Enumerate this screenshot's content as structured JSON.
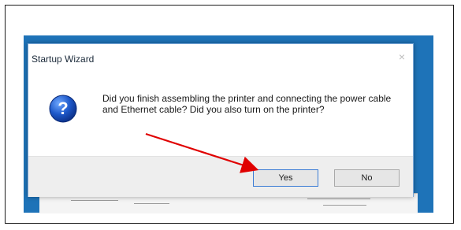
{
  "dialog": {
    "title": "Startup Wizard",
    "close_glyph": "×",
    "icon": "question-icon",
    "message": "Did you finish assembling the printer and connecting the power cable and Ethernet cable? Did you also turn on the printer?",
    "buttons": {
      "yes": "Yes",
      "no": "No"
    },
    "default_button": "yes"
  },
  "annotation": {
    "arrow_color": "#e00000",
    "points_to": "yes-button"
  },
  "colors": {
    "background_strip": "#1e73b8",
    "dialog_border": "#7aa7d6",
    "footer": "#eeeeee"
  }
}
